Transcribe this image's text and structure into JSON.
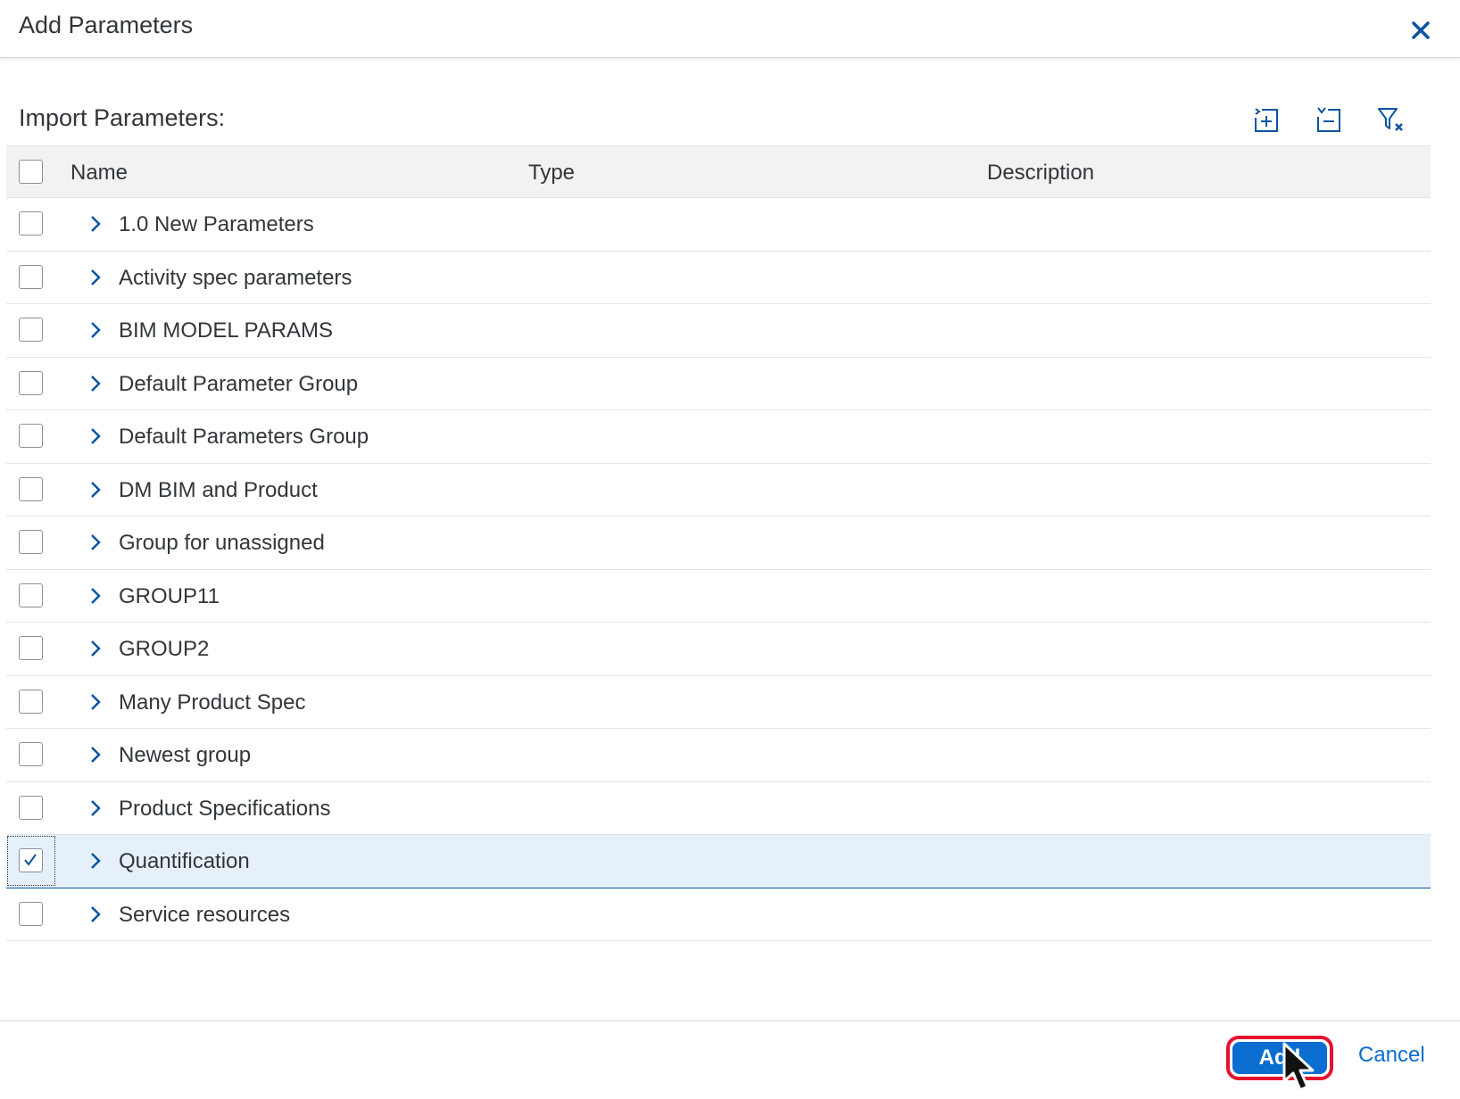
{
  "dialog": {
    "title": "Add Parameters",
    "close_icon": "close-icon"
  },
  "section": {
    "title": "Import Parameters:",
    "toolbar": [
      {
        "name": "expand-all-icon"
      },
      {
        "name": "collapse-all-icon"
      },
      {
        "name": "clear-filter-icon"
      }
    ]
  },
  "table": {
    "columns": [
      "Name",
      "Type",
      "Description"
    ],
    "rows": [
      {
        "label": "1.0 New Parameters",
        "checked": false
      },
      {
        "label": "Activity spec parameters",
        "checked": false
      },
      {
        "label": "BIM MODEL PARAMS",
        "checked": false
      },
      {
        "label": "Default Parameter Group",
        "checked": false
      },
      {
        "label": "Default Parameters Group",
        "checked": false
      },
      {
        "label": "DM BIM and Product",
        "checked": false
      },
      {
        "label": "Group for unassigned",
        "checked": false
      },
      {
        "label": "GROUP11",
        "checked": false
      },
      {
        "label": "GROUP2",
        "checked": false
      },
      {
        "label": "Many Product Spec",
        "checked": false
      },
      {
        "label": "Newest group",
        "checked": false
      },
      {
        "label": "Product Specifications",
        "checked": false
      },
      {
        "label": "Quantification",
        "checked": true
      },
      {
        "label": "Service resources",
        "checked": false
      }
    ]
  },
  "footer": {
    "add_label": "Add",
    "cancel_label": "Cancel"
  },
  "colors": {
    "accent": "#0a6ed1",
    "icon": "#0854a0",
    "selected_row": "#e5f0fa",
    "highlight_outline": "#e5132d"
  }
}
